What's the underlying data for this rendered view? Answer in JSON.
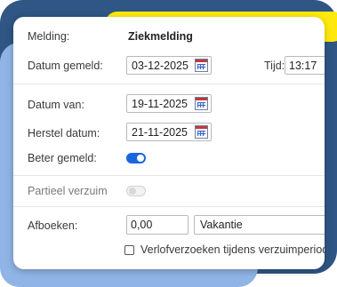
{
  "form": {
    "melding": {
      "label": "Melding:",
      "value": "Ziekmelding"
    },
    "datum_gemeld": {
      "label": "Datum gemeld:",
      "value": "03-12-2025"
    },
    "tijd": {
      "label": "Tijd:",
      "value": "13:17"
    },
    "datum_van": {
      "label": "Datum van:",
      "value": "19-11-2025"
    },
    "herstel_datum": {
      "label": "Herstel datum:",
      "value": "21-11-2025"
    },
    "beter_gemeld": {
      "label": "Beter gemeld:",
      "checked": true
    },
    "partieel_verzuim": {
      "label": "Partieel verzuim",
      "checked": false,
      "disabled": true
    },
    "afboeken": {
      "label": "Afboeken:",
      "amount": "0,00",
      "type": "Vakantie"
    },
    "verlof_checkbox": {
      "label": "Verlofverzoeken tijdens verzuimperiode v",
      "checked": false
    }
  },
  "colors": {
    "navy_bg": "#2f5684",
    "yellow_accent": "#ffe90c",
    "lightblue_accent": "#8fb4e5",
    "toggle_on": "#1a66e0"
  }
}
